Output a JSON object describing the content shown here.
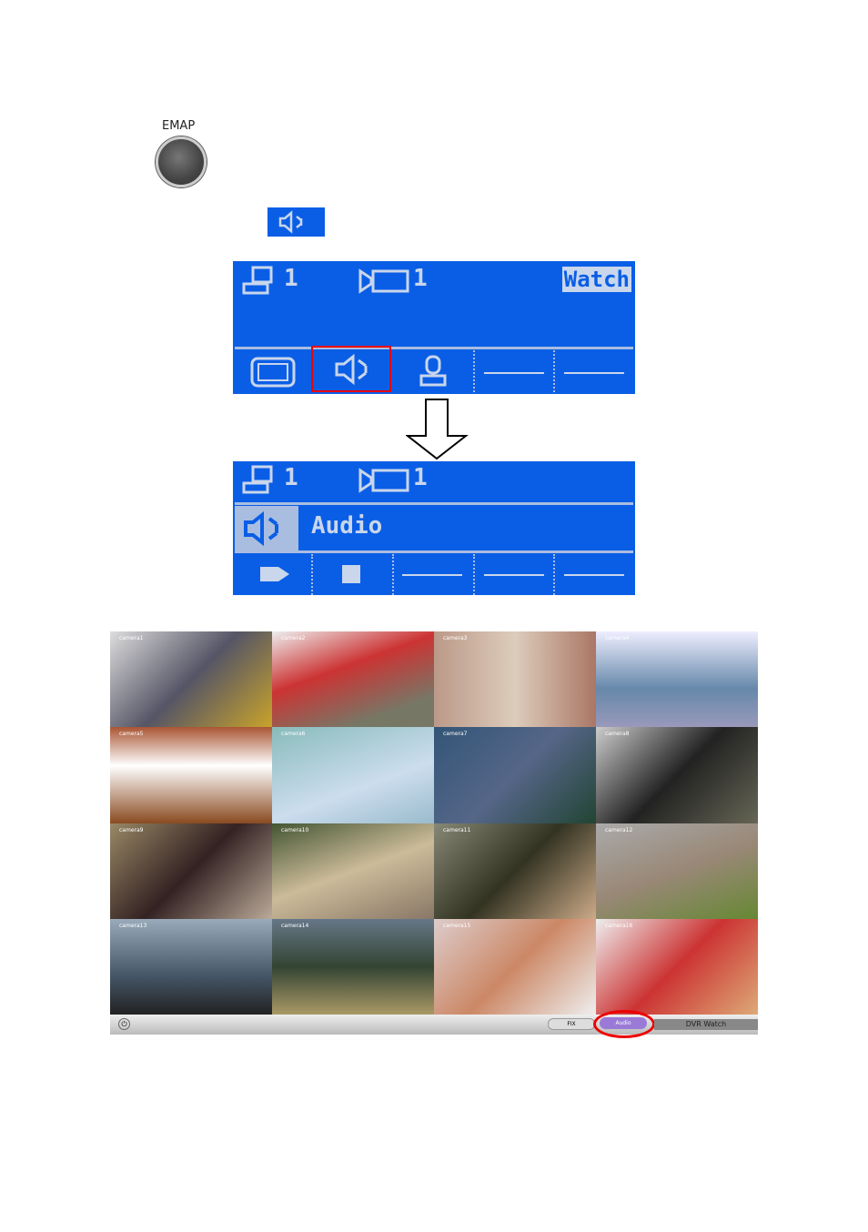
{
  "emap": {
    "label": "EMAP"
  },
  "panel1": {
    "dvr_num": "1",
    "cam_num": "1",
    "mode": "Watch"
  },
  "panel2": {
    "dvr_num": "1",
    "cam_num": "1",
    "mode": "Audio"
  },
  "colors": {
    "lcd_blue": "#0a5ee6",
    "highlight_red": "#e00000"
  },
  "cameras": [
    {
      "label": "camera1",
      "bg": "linear-gradient(135deg,#ddd,#556 50%,#c9a32a)"
    },
    {
      "label": "camera2",
      "bg": "linear-gradient(160deg,#eee,#c33 40%,#776 80%)"
    },
    {
      "label": "camera3",
      "bg": "linear-gradient(90deg,#b98,#dcb 50%,#a76)"
    },
    {
      "label": "camera4",
      "bg": "linear-gradient(180deg,#eef,#68a 60%,#99b)"
    },
    {
      "label": "camera5",
      "bg": "linear-gradient(180deg,#a53,#fff 40%,#8a4a20)"
    },
    {
      "label": "camera6",
      "bg": "linear-gradient(160deg,#8bb,#cde 60%,#9bc)"
    },
    {
      "label": "camera7",
      "bg": "linear-gradient(135deg,#357,#568 50%,#243)"
    },
    {
      "label": "camera8",
      "bg": "linear-gradient(135deg,#ccc,#222 50%,#665)"
    },
    {
      "label": "camera9",
      "bg": "linear-gradient(135deg,#986,#322 50%,#ba9)"
    },
    {
      "label": "camera10",
      "bg": "linear-gradient(160deg,#453,#cb9 50%,#876)"
    },
    {
      "label": "camera11",
      "bg": "linear-gradient(135deg,#887,#332 50%,#ca8)"
    },
    {
      "label": "camera12",
      "bg": "linear-gradient(160deg,#aaa,#987 50%,#683)"
    },
    {
      "label": "camera13",
      "bg": "linear-gradient(180deg,#9ab,#456 60%,#222)"
    },
    {
      "label": "camera14",
      "bg": "linear-gradient(180deg,#678,#343 50%,#a96)"
    },
    {
      "label": "camera15",
      "bg": "linear-gradient(135deg,#dcc,#c86 50%,#eee)"
    },
    {
      "label": "camera16",
      "bg": "linear-gradient(135deg,#eee,#c33 50%,#da7)"
    }
  ],
  "toolbar": {
    "fix_label": "FIX",
    "audio_label": "Audio",
    "dvr_label": "DVR Watch"
  }
}
